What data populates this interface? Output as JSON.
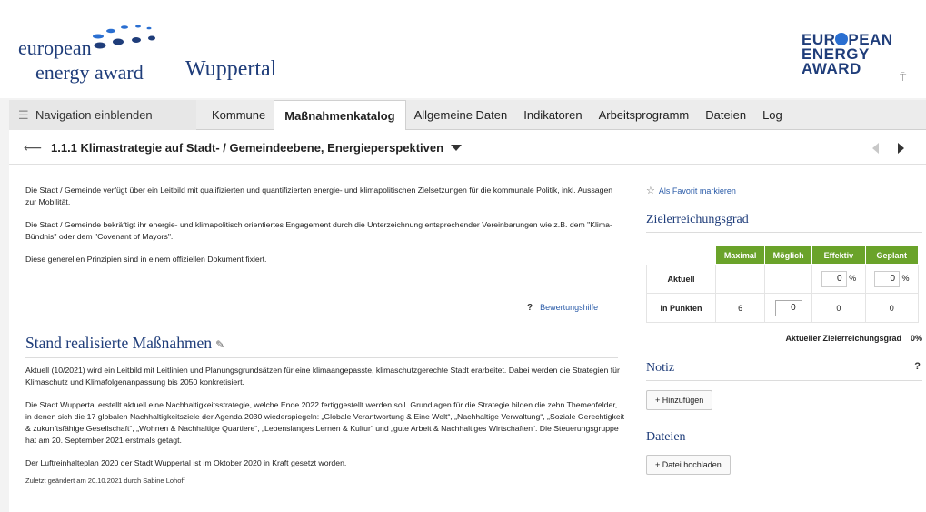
{
  "header": {
    "logo_left": {
      "line1": "european",
      "line2": "energy award"
    },
    "city": "Wuppertal",
    "logo_right": {
      "line1_a": "EUR",
      "line1_b": "PEAN",
      "line2": "ENERGY",
      "line3": "AWARD"
    },
    "pin_icon": "pin-icon"
  },
  "tabbar": {
    "nav_toggle": "Navigation einblenden",
    "tabs": [
      {
        "label": "Kommune",
        "active": false
      },
      {
        "label": "Maßnahmenkatalog",
        "active": true
      },
      {
        "label": "Allgemeine Daten",
        "active": false
      },
      {
        "label": "Indikatoren",
        "active": false
      },
      {
        "label": "Arbeitsprogramm",
        "active": false
      },
      {
        "label": "Dateien",
        "active": false
      },
      {
        "label": "Log",
        "active": false
      }
    ]
  },
  "measure": {
    "title": "1.1.1 Klimastrategie auf Stadt- / Gemeindeebene, Energieperspektiven"
  },
  "description": [
    "Die Stadt / Gemeinde verfügt über ein Leitbild mit qualifizierten und quantifizierten energie- und klimapolitischen Zielsetzungen für die kommunale Politik, inkl. Aussagen zur Mobilität.",
    "Die Stadt / Gemeinde bekräftigt ihr energie- und klimapolitisch orientiertes Engagement durch die Unterzeichnung entsprechender Vereinbarungen wie z.B. dem \"Klima-Bündnis\" oder dem \"Covenant of Mayors\".",
    "Diese generellen Prinzipien sind in einem offiziellen Dokument fixiert."
  ],
  "help_link": "Bewertungshilfe",
  "status": {
    "title": "Stand realisierte Maßnahmen",
    "paragraphs": [
      "Aktuell (10/2021) wird ein Leitbild mit Leitlinien und Planungsgrundsätzen für eine klimaangepasste, klimaschutzgerechte Stadt erarbeitet. Dabei werden die Strategien für Klimaschutz und Klimafolgenanpassung bis 2050 konkretisiert.",
      "Die Stadt Wuppertal erstellt aktuell eine Nachhaltigkeitsstrategie, welche Ende 2022 fertiggestellt werden soll. Grundlagen für die Strategie bilden die zehn Themenfelder, in denen sich die 17 globalen Nachhaltigkeitsziele der Agenda 2030 wiederspiegeln: „Globale Verantwortung & Eine Welt“, „Nachhaltige Verwaltung“, „Soziale Gerechtigkeit & zukunftsfähige Gesellschaft“, „Wohnen & Nachhaltige Quartiere“, „Lebenslanges Lernen & Kultur“ und „gute Arbeit & Nachhaltiges Wirtschaften“. Die Steuerungsgruppe hat am 20. September 2021 erstmals getagt.",
      "Der Luftreinhalteplan 2020 der Stadt Wuppertal ist im Oktober 2020 in Kraft gesetzt worden."
    ],
    "updated": "Zuletzt geändert am 20.10.2021 durch Sabine Lohoff"
  },
  "sidebar": {
    "favorite": "Als Favorit markieren",
    "goal_heading": "Zielerreichungsgrad",
    "table": {
      "headers": [
        "",
        "Maximal",
        "Möglich",
        "Effektiv",
        "Geplant"
      ],
      "row_current": {
        "label": "Aktuell",
        "effektiv": "0",
        "geplant": "0",
        "unit": "%"
      },
      "row_points": {
        "label": "In Punkten",
        "maximal": "6",
        "moeglich": "0",
        "effektiv": "0",
        "geplant": "0"
      }
    },
    "summary_label": "Aktueller Zielerreichungsgrad",
    "summary_value": "0%",
    "note_heading": "Notiz",
    "note_help": "?",
    "add_button": "+ Hinzufügen",
    "files_heading": "Dateien",
    "upload_button": "+ Datei hochladen"
  },
  "colors": {
    "brand_blue": "#1f3d7a",
    "link_blue": "#2a5ba8",
    "table_green": "#6aa32a"
  }
}
